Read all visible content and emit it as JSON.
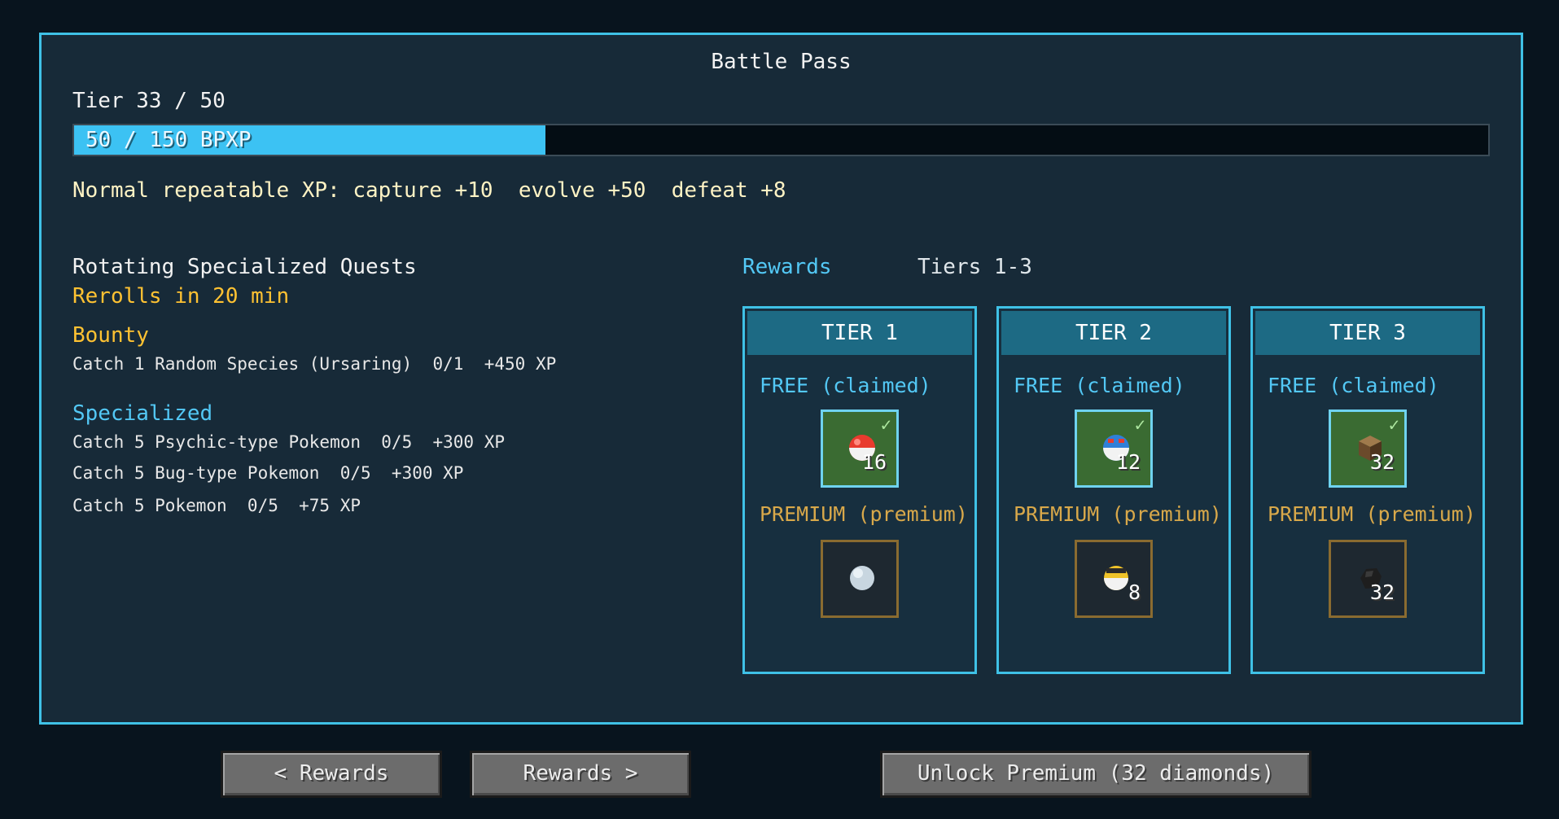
{
  "title": "Battle Pass",
  "tier_label": "Tier 33 / 50",
  "xp": {
    "text": "50 / 150 BPXP",
    "current": 50,
    "max": 150
  },
  "normal_xp": "Normal repeatable XP: capture +10  evolve +50  defeat +8",
  "quests": {
    "title": "Rotating Specialized Quests",
    "rerolls": "Rerolls in 20 min",
    "bounty_header": "Bounty",
    "bounty_line": "Catch 1 Random Species (Ursaring)  0/1  +450 XP",
    "specialized_header": "Specialized",
    "specialized": [
      "Catch 5 Psychic-type Pokemon  0/5  +300 XP",
      "Catch 5 Bug-type Pokemon  0/5  +300 XP",
      "Catch 5 Pokemon  0/5  +75 XP"
    ]
  },
  "rewards": {
    "tab_label": "Rewards",
    "range_label": "Tiers 1-3",
    "tiers": [
      {
        "name": "TIER 1",
        "free_label": "FREE (claimed)",
        "free_item": {
          "icon": "poke-ball-icon",
          "count": "16",
          "claimed": true
        },
        "premium_label": "PREMIUM (premium)",
        "premium_item": {
          "icon": "snowball-icon",
          "count": ""
        }
      },
      {
        "name": "TIER 2",
        "free_label": "FREE (claimed)",
        "free_item": {
          "icon": "great-ball-icon",
          "count": "12",
          "claimed": true
        },
        "premium_label": "PREMIUM (premium)",
        "premium_item": {
          "icon": "ultra-ball-icon",
          "count": "8"
        }
      },
      {
        "name": "TIER 3",
        "free_label": "FREE (claimed)",
        "free_item": {
          "icon": "log-block-icon",
          "count": "32",
          "claimed": true
        },
        "premium_label": "PREMIUM (premium)",
        "premium_item": {
          "icon": "coal-icon",
          "count": "32"
        }
      }
    ]
  },
  "buttons": {
    "prev": "< Rewards",
    "next": "Rewards >",
    "unlock": "Unlock Premium (32 diamonds)"
  },
  "colors": {
    "accent": "#3fc1e6",
    "xp_fill": "#3cc2f3",
    "gold": "#ffc232",
    "panel": "#172a38"
  }
}
